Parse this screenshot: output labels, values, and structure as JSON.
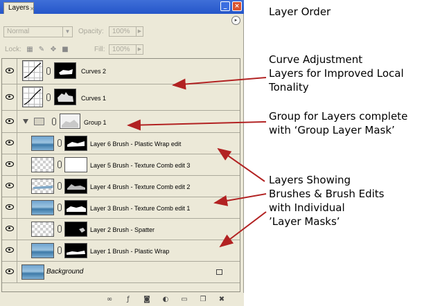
{
  "panel": {
    "tab_label": "Layers",
    "tab_close": "×",
    "minimize_glyph": "_",
    "close_glyph": "×",
    "menu_glyph": "▸",
    "blend_mode": "Normal",
    "opacity_label": "Opacity:",
    "opacity_value": "100%",
    "lock_label": "Lock:",
    "fill_label": "Fill:",
    "fill_value": "100%"
  },
  "layers": [
    {
      "name": "Curves 2",
      "type": "adjustment"
    },
    {
      "name": "Curves 1",
      "type": "adjustment"
    },
    {
      "name": "Group 1",
      "type": "group"
    },
    {
      "name": "Layer 6 Brush - Plastic Wrap edit",
      "type": "layer"
    },
    {
      "name": "Layer 5 Brush - Texture Comb edit 3",
      "type": "layer"
    },
    {
      "name": "Layer 4 Brush - Texture Comb edit 2",
      "type": "layer"
    },
    {
      "name": "Layer 3 Brush - Texture Comb edit 1",
      "type": "layer"
    },
    {
      "name": "Layer 2 Brush - Spatter",
      "type": "layer"
    },
    {
      "name": "Layer 1 Brush - Plastic Wrap",
      "type": "layer"
    },
    {
      "name": "Background",
      "type": "background"
    }
  ],
  "bottom_icons": [
    "link-icon",
    "fx-icon",
    "mask-icon",
    "adjustment-icon",
    "folder-icon",
    "new-layer-icon",
    "trash-icon"
  ],
  "annotations": {
    "title": "Layer Order",
    "curves": [
      "Curve Adjustment",
      "Layers for Improved Local",
      "Tonality"
    ],
    "group": [
      "Group for Layers complete",
      "with ‘Group Layer Mask’"
    ],
    "layers": [
      "Layers Showing",
      "Brushes & Brush Edits",
      "with Individual",
      "’Layer Masks’"
    ]
  },
  "colors": {
    "titlebar": "#2556c9",
    "panel_bg": "#ece9d8",
    "arrow": "#b22222"
  }
}
